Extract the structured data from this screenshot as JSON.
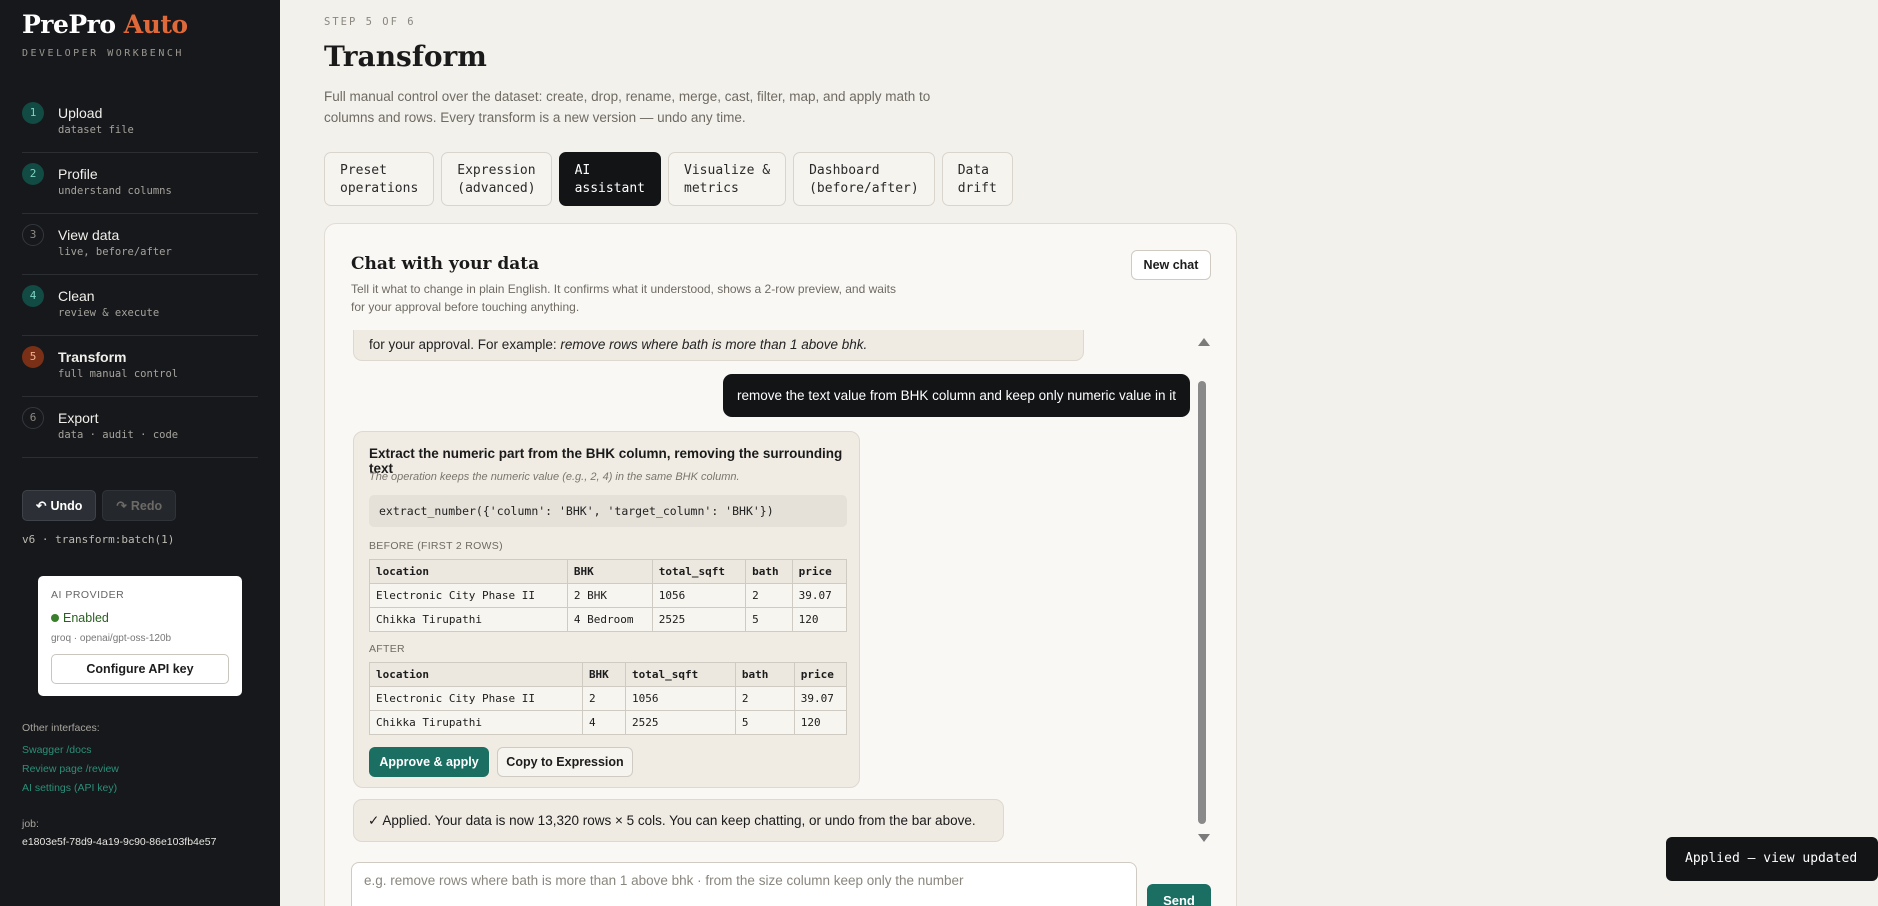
{
  "brand": {
    "name": "PrePro",
    "accent": "Auto",
    "subtitle": "DEVELOPER WORKBENCH"
  },
  "steps": [
    {
      "num": "1",
      "title": "Upload",
      "sub": "dataset file",
      "state": "done"
    },
    {
      "num": "2",
      "title": "Profile",
      "sub": "understand columns",
      "state": "done"
    },
    {
      "num": "3",
      "title": "View data",
      "sub": "live, before/after",
      "state": "pending"
    },
    {
      "num": "4",
      "title": "Clean",
      "sub": "review & execute",
      "state": "done"
    },
    {
      "num": "5",
      "title": "Transform",
      "sub": "full manual control",
      "state": "current"
    },
    {
      "num": "6",
      "title": "Export",
      "sub": "data · audit · code",
      "state": "pending"
    }
  ],
  "history": {
    "undo_label": "Undo",
    "redo_label": "Redo",
    "version": "v6 · transform:batch(1)"
  },
  "provider": {
    "label": "AI PROVIDER",
    "status": "Enabled",
    "model": "groq · openai/gpt-oss-120b",
    "configure_label": "Configure API key"
  },
  "other": {
    "label": "Other interfaces:",
    "links": [
      "Swagger /docs",
      "Review page /review",
      "AI settings (API key)"
    ]
  },
  "job": {
    "label": "job:",
    "id": "e1803e5f-78d9-4a19-9c90-86e103fb4e57"
  },
  "header": {
    "step_label": "STEP 5 OF 6",
    "title": "Transform",
    "description": "Full manual control over the dataset: create, drop, rename, merge, cast, filter, map, and apply math to columns and rows. Every transform is a new version — undo any time."
  },
  "tabs": [
    {
      "label": "Preset\noperations",
      "active": false
    },
    {
      "label": "Expression\n(advanced)",
      "active": false
    },
    {
      "label": "AI\nassistant",
      "active": true
    },
    {
      "label": "Visualize &\nmetrics",
      "active": false
    },
    {
      "label": "Dashboard\n(before/after)",
      "active": false
    },
    {
      "label": "Data\ndrift",
      "active": false
    }
  ],
  "chat": {
    "title": "Chat with your data",
    "description": "Tell it what to change in plain English. It confirms what it understood, shows a 2-row preview, and waits for your approval before touching anything.",
    "new_chat_label": "New chat",
    "system_msg_prefix": "for your approval. For example: ",
    "system_msg_example": "remove rows where bath is more than 1 above bhk.",
    "user_msg": "remove the text value from BHK column and keep only numeric value in it",
    "ai": {
      "title": "Extract the numeric part from the BHK column, removing the surrounding text",
      "note": "The operation keeps the numeric value (e.g., 2, 4) in the same BHK column.",
      "code": "extract_number({'column': 'BHK', 'target_column': 'BHK'})",
      "before_label": "BEFORE (FIRST 2 ROWS)",
      "after_label": "AFTER",
      "columns": [
        "location",
        "BHK",
        "total_sqft",
        "bath",
        "price"
      ],
      "before_rows": [
        [
          "Electronic City Phase II",
          "2 BHK",
          "1056",
          "2",
          "39.07"
        ],
        [
          "Chikka Tirupathi",
          "4 Bedroom",
          "2525",
          "5",
          "120"
        ]
      ],
      "after_rows": [
        [
          "Electronic City Phase II",
          "2",
          "1056",
          "2",
          "39.07"
        ],
        [
          "Chikka Tirupathi",
          "4",
          "2525",
          "5",
          "120"
        ]
      ],
      "approve_label": "Approve & apply",
      "copy_label": "Copy to Expression"
    },
    "applied_msg": "✓ Applied. Your data is now 13,320 rows × 5 cols. You can keep chatting, or undo from the bar above.",
    "input_placeholder": "e.g. remove rows where bath is more than 1 above bhk  ·  from the size column keep only the number",
    "send_label": "Send"
  },
  "toast": "Applied — view updated",
  "colors": {
    "accent": "#e0693a",
    "primary": "#1a6e62",
    "sidebar": "#16181b",
    "background": "#f3f1ec"
  }
}
